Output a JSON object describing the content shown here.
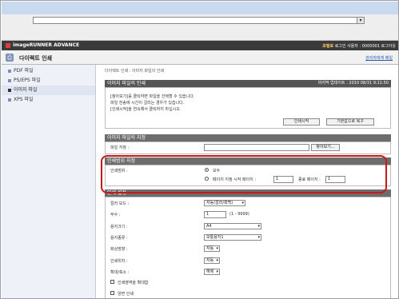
{
  "brand": {
    "accent": "#c81818",
    "header_dark": "#3a3a3a",
    "section_gray": "#6d6d6d"
  },
  "app": {
    "name": "imageRUNNER ADVANCE",
    "user_text": "로그인 사용자 : 0000001 로그아웃",
    "user_highlight": "포털로"
  },
  "header": {
    "title": "다이렉트 인쇄",
    "link": "관리자에게 메일",
    "icon": "print-icon"
  },
  "sidebar": {
    "items": [
      {
        "label": "PDF 파일",
        "active": false
      },
      {
        "label": "PS/EPS 파일",
        "active": false
      },
      {
        "label": "이미지 파일",
        "active": true
      },
      {
        "label": "XPS 파일",
        "active": false
      }
    ]
  },
  "breadcrumb": "다이렉트 인쇄 : 이미지 파일의 인쇄",
  "print_section": {
    "title": "이미지 파일의 인쇄",
    "updated": "마지막 업데이트 : 2010 08/31 9:11:50",
    "messages": [
      "[참아보기]를 클릭하면 파일을 선택할 수 있습니다.",
      "파일 전송에 시간이 걸리는 경우가 있습니다.",
      "[인쇄시작]을 연속해서 클릭하지 마십시오."
    ],
    "start_button": "인쇄시작",
    "reset_button": "기본값으로 복구"
  },
  "file_section": {
    "title": "이미지 파일의 지정",
    "label": "파일 지정 :",
    "browse_button": "찾아보기..."
  },
  "range_section": {
    "title": "인쇄범위 지정",
    "label": "인쇄범위 :",
    "option_all": "모두",
    "option_pages": "페이지 지정 시작 페이지 :",
    "start_value": "1",
    "end_label": "종료 페이지 :",
    "end_value": "1"
  },
  "settings_section": {
    "title": "인쇄 설정",
    "rows": [
      {
        "label": "컬러 모드 :",
        "value": "자동(컬러/흑백)"
      },
      {
        "label": "부수 :",
        "value": "1",
        "hint": "(1 - 9999)"
      },
      {
        "label": "용지크기 :",
        "value": "A4"
      },
      {
        "label": "용지종류 :",
        "value": "보통용지1"
      },
      {
        "label": "화상방향 :",
        "value": "자동"
      },
      {
        "label": "인쇄위치 :",
        "value": "자동"
      },
      {
        "label": "확대/축소 :",
        "value": "해제"
      }
    ],
    "checks": [
      {
        "label": "인쇄영역을 확대함"
      },
      {
        "label": "양면 인쇄"
      }
    ]
  }
}
